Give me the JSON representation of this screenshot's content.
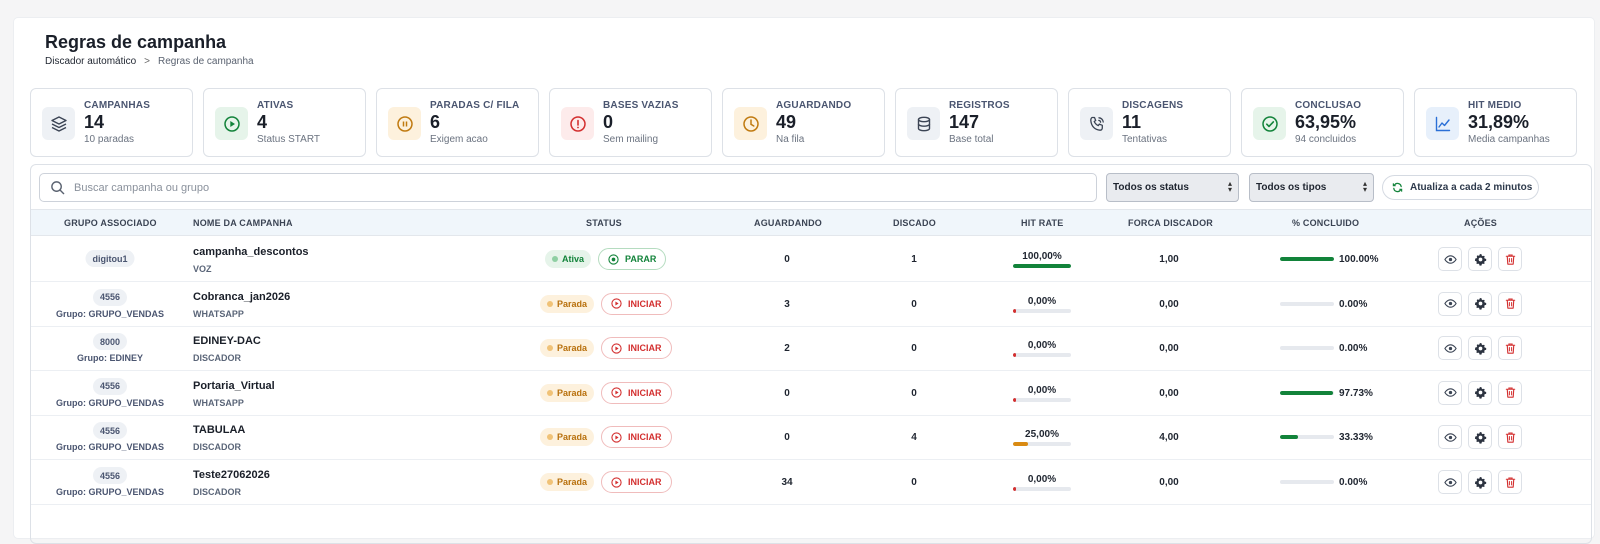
{
  "header": {
    "title": "Regras de campanha",
    "breadcrumb": [
      "Discador automático",
      ">",
      "Regras de campanha"
    ]
  },
  "cards": [
    {
      "label": "CAMPANHAS",
      "value": "14",
      "sub": "10 paradas",
      "icon": "layers-icon",
      "bg": "#eef1f5",
      "fg": "#3b4454"
    },
    {
      "label": "ATIVAS",
      "value": "4",
      "sub": "Status START",
      "icon": "play-circle-icon",
      "bg": "#e6f4ea",
      "fg": "#12833a"
    },
    {
      "label": "PARADAS C/ FILA",
      "value": "6",
      "sub": "Exigem acao",
      "icon": "pause-circle-icon",
      "bg": "#fdf1dd",
      "fg": "#c07a10"
    },
    {
      "label": "BASES VAZIAS",
      "value": "0",
      "sub": "Sem mailing",
      "icon": "alert-circle-icon",
      "bg": "#fdebeb",
      "fg": "#d32f2f"
    },
    {
      "label": "AGUARDANDO",
      "value": "49",
      "sub": "Na fila",
      "icon": "clock-icon",
      "bg": "#fdf1dd",
      "fg": "#c07a10"
    },
    {
      "label": "REGISTROS",
      "value": "147",
      "sub": "Base total",
      "icon": "database-icon",
      "bg": "#eef1f5",
      "fg": "#3b4454"
    },
    {
      "label": "DISCAGENS",
      "value": "11",
      "sub": "Tentativas",
      "icon": "phone-call-icon",
      "bg": "#eef1f5",
      "fg": "#3b4454"
    },
    {
      "label": "CONCLUSAO",
      "value": "63,95%",
      "sub": "94 concluidos",
      "icon": "check-circle-icon",
      "bg": "#e6f4ea",
      "fg": "#12833a"
    },
    {
      "label": "HIT MEDIO",
      "value": "31,89%",
      "sub": "Media campanhas",
      "icon": "trend-icon",
      "bg": "#e7f0fb",
      "fg": "#2a6fd6"
    }
  ],
  "toolbar": {
    "search_placeholder": "Buscar campanha ou grupo",
    "status_filter": "Todos os status",
    "type_filter": "Todos os tipos",
    "refresh_label": "Atualiza a cada 2 minutos"
  },
  "table": {
    "columns": [
      "GRUPO ASSOCIADO",
      "NOME DA CAMPANHA",
      "STATUS",
      "AGUARDANDO",
      "DISCADO",
      "HIT RATE",
      "FORCA DISCADOR",
      "% CONCLUIDO",
      "AÇÕES"
    ],
    "rows": [
      {
        "group": "digitou1",
        "group_sub": "",
        "name": "campanha_descontos",
        "type": "VOZ",
        "status": "Ativa",
        "active": true,
        "action": "PARAR",
        "waiting": "0",
        "dialed": "1",
        "hit_label": "100,00%",
        "hit": 100,
        "force": "1,00",
        "pct_label": "100.00%",
        "pct": 100
      },
      {
        "group": "4556",
        "group_sub": "Grupo: GRUPO_VENDAS",
        "name": "Cobranca_jan2026",
        "type": "WHATSAPP",
        "status": "Parada",
        "active": false,
        "action": "INICIAR",
        "waiting": "3",
        "dialed": "0",
        "hit_label": "0,00%",
        "hit": 0,
        "force": "0,00",
        "pct_label": "0.00%",
        "pct": 0
      },
      {
        "group": "8000",
        "group_sub": "Grupo: EDINEY",
        "name": "EDINEY-DAC",
        "type": "DISCADOR",
        "status": "Parada",
        "active": false,
        "action": "INICIAR",
        "waiting": "2",
        "dialed": "0",
        "hit_label": "0,00%",
        "hit": 0,
        "force": "0,00",
        "pct_label": "0.00%",
        "pct": 0
      },
      {
        "group": "4556",
        "group_sub": "Grupo: GRUPO_VENDAS",
        "name": "Portaria_Virtual",
        "type": "WHATSAPP",
        "status": "Parada",
        "active": false,
        "action": "INICIAR",
        "waiting": "0",
        "dialed": "0",
        "hit_label": "0,00%",
        "hit": 0,
        "force": "0,00",
        "pct_label": "97.73%",
        "pct": 97.73
      },
      {
        "group": "4556",
        "group_sub": "Grupo: GRUPO_VENDAS",
        "name": "TABULAA",
        "type": "DISCADOR",
        "status": "Parada",
        "active": false,
        "action": "INICIAR",
        "waiting": "0",
        "dialed": "4",
        "hit_label": "25,00%",
        "hit": 25,
        "force": "4,00",
        "pct_label": "33.33%",
        "pct": 33.33
      },
      {
        "group": "4556",
        "group_sub": "Grupo: GRUPO_VENDAS",
        "name": "Teste27062026",
        "type": "DISCADOR",
        "status": "Parada",
        "active": false,
        "action": "INICIAR",
        "waiting": "34",
        "dialed": "0",
        "hit_label": "0,00%",
        "hit": 0,
        "force": "0,00",
        "pct_label": "0.00%",
        "pct": 0
      }
    ]
  },
  "colors": {
    "green": "#12833a",
    "orange": "#d98a12",
    "red": "#d32f2f"
  }
}
